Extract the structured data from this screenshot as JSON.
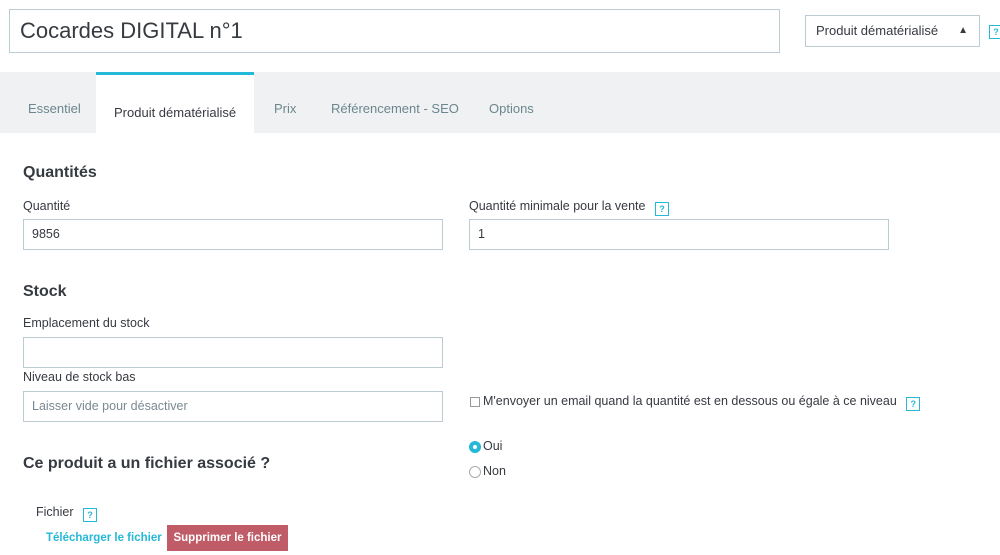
{
  "header": {
    "product_name": "Cocardes DIGITAL n°1",
    "product_type": "Produit dématérialisé",
    "help": "?"
  },
  "tabs": [
    {
      "label": "Essentiel"
    },
    {
      "label": "Produit dématérialisé"
    },
    {
      "label": "Prix"
    },
    {
      "label": "Référencement - SEO"
    },
    {
      "label": "Options"
    }
  ],
  "quantities": {
    "title": "Quantités",
    "quantity_label": "Quantité",
    "quantity_value": "9856",
    "min_qty_label": "Quantité minimale pour la vente",
    "min_qty_value": "1"
  },
  "stock": {
    "title": "Stock",
    "location_label": "Emplacement du stock",
    "location_value": "",
    "low_level_label": "Niveau de stock bas",
    "low_level_placeholder": "Laisser vide pour désactiver",
    "email_label": "M'envoyer un email quand la quantité est en dessous ou égale à ce niveau"
  },
  "file": {
    "question": "Ce produit a un fichier associé ?",
    "options": [
      "Oui",
      "Non"
    ],
    "selected": "Oui",
    "file_label": "Fichier",
    "download_label": "Télécharger le fichier",
    "delete_label": "Supprimer le fichier"
  },
  "colors": {
    "accent": "#25b9d7",
    "danger": "#c05c67",
    "tabbar_bg": "#eff1f2"
  }
}
